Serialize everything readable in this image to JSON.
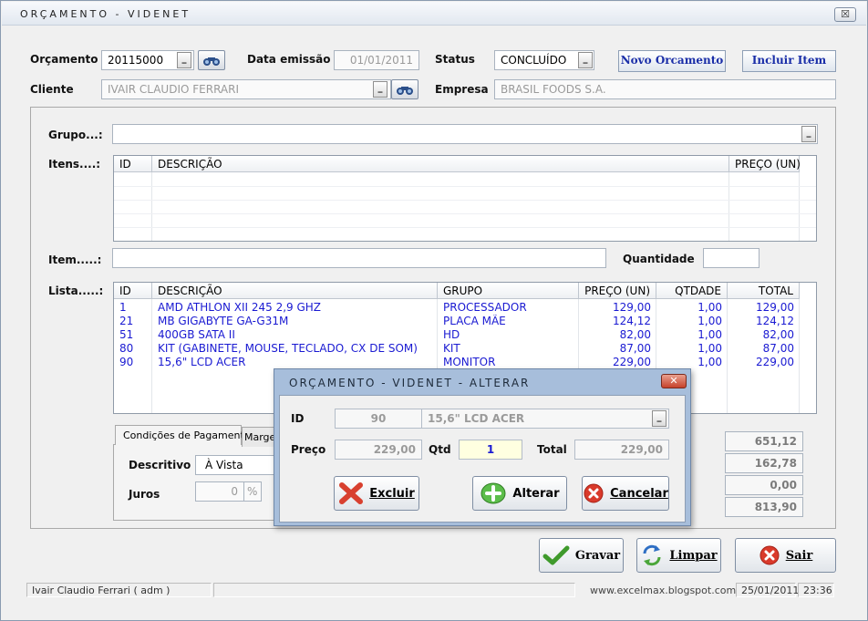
{
  "window": {
    "title": "ORÇAMENTO - VIDENET",
    "close_glyph": "☒"
  },
  "header": {
    "orcamento_label": "Orçamento",
    "orcamento_value": "20115000",
    "data_label": "Data emissão",
    "data_value": "01/01/2011",
    "status_label": "Status",
    "status_value": "CONCLUÍDO",
    "novo_label": "Novo Orcamento",
    "incluir_label": "Incluir Item",
    "cliente_label": "Cliente",
    "cliente_value": "IVAIR CLAUDIO FERRARI",
    "empresa_label": "Empresa",
    "empresa_value": "BRASIL FOODS S.A."
  },
  "grupo": {
    "label": "Grupo...:",
    "value": ""
  },
  "itens": {
    "label": "Itens....:",
    "columns": [
      "ID",
      "DESCRIÇÃO",
      "PREÇO (UN)"
    ]
  },
  "item": {
    "label": "Item.....:",
    "value": "",
    "quantidade_label": "Quantidade",
    "quantidade_value": ""
  },
  "lista": {
    "label": "Lista.....:",
    "columns": [
      "ID",
      "DESCRIÇÃO",
      "GRUPO",
      "PREÇO (UN)",
      "QTDADE",
      "TOTAL"
    ],
    "rows": [
      [
        "1",
        "AMD ATHLON XII 245 2,9 GHZ",
        "PROCESSADOR",
        "129,00",
        "1,00",
        "129,00"
      ],
      [
        "21",
        "MB GIGABYTE GA-G31M",
        "PLACA MÃE",
        "124,12",
        "1,00",
        "124,12"
      ],
      [
        "51",
        "400GB SATA II",
        "HD",
        "82,00",
        "1,00",
        "82,00"
      ],
      [
        "80",
        "KIT (GABINETE, MOUSE, TECLADO, CX DE SOM)",
        "KIT",
        "87,00",
        "1,00",
        "87,00"
      ],
      [
        "90",
        "15,6\" LCD ACER",
        "MONITOR",
        "229,00",
        "1,00",
        "229,00"
      ]
    ]
  },
  "tabs": {
    "items": [
      "Condições de Pagamento",
      "Marge"
    ],
    "descritivo_label": "Descritivo",
    "descritivo_value": "À Vista",
    "juros_label": "Juros",
    "juros_value": "0",
    "juros_unit": "%"
  },
  "totals": [
    "651,12",
    "162,78",
    "0,00",
    "813,90"
  ],
  "buttons": {
    "gravar": "Gravar",
    "limpar": "Limpar",
    "sair": "Sair"
  },
  "statusbar": {
    "user": "Ivair Claudio Ferrari ( adm )",
    "site": "www.excelmax.blogspot.com",
    "date": "25/01/2011",
    "time": "23:36"
  },
  "dialog": {
    "title": "ORÇAMENTO - VIDENET - ALTERAR",
    "close_glyph": "✕",
    "id_label": "ID",
    "id_value": "90",
    "desc_value": "15,6\" LCD ACER",
    "preco_label": "Preço",
    "preco_value": "229,00",
    "qtd_label": "Qtd",
    "qtd_value": "1",
    "total_label": "Total",
    "total_value": "229,00",
    "excluir": "Excluir",
    "alterar": "Alterar",
    "cancelar": "Cancelar"
  }
}
